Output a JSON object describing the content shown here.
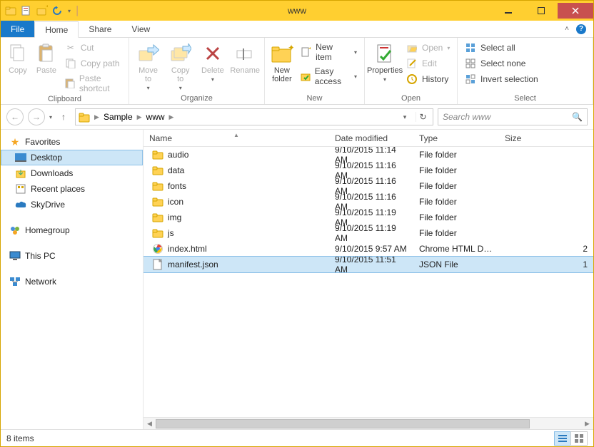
{
  "window": {
    "title": "www"
  },
  "tabs": {
    "file": "File",
    "home": "Home",
    "share": "Share",
    "view": "View"
  },
  "ribbon": {
    "clipboard": {
      "group": "Clipboard",
      "copy": "Copy",
      "paste": "Paste",
      "cut": "Cut",
      "copy_path": "Copy path",
      "paste_shortcut": "Paste shortcut"
    },
    "organize": {
      "group": "Organize",
      "move_to": "Move\nto",
      "copy_to": "Copy\nto",
      "delete": "Delete",
      "rename": "Rename"
    },
    "new": {
      "group": "New",
      "new_folder": "New\nfolder",
      "new_item": "New item",
      "easy_access": "Easy access"
    },
    "open": {
      "group": "Open",
      "properties": "Properties",
      "open": "Open",
      "edit": "Edit",
      "history": "History"
    },
    "select": {
      "group": "Select",
      "select_all": "Select all",
      "select_none": "Select none",
      "invert": "Invert selection"
    }
  },
  "nav": {
    "crumbs": [
      "Sample",
      "www"
    ],
    "search_placeholder": "Search www"
  },
  "sidebar": {
    "favorites": "Favorites",
    "items_fav": [
      "Desktop",
      "Downloads",
      "Recent places",
      "SkyDrive"
    ],
    "homegroup": "Homegroup",
    "this_pc": "This PC",
    "network": "Network"
  },
  "columns": {
    "name": "Name",
    "date": "Date modified",
    "type": "Type",
    "size": "Size"
  },
  "files": [
    {
      "icon": "folder",
      "name": "audio",
      "date": "9/10/2015 11:14 AM",
      "type": "File folder",
      "size": ""
    },
    {
      "icon": "folder",
      "name": "data",
      "date": "9/10/2015 11:16 AM",
      "type": "File folder",
      "size": ""
    },
    {
      "icon": "folder",
      "name": "fonts",
      "date": "9/10/2015 11:16 AM",
      "type": "File folder",
      "size": ""
    },
    {
      "icon": "folder",
      "name": "icon",
      "date": "9/10/2015 11:16 AM",
      "type": "File folder",
      "size": ""
    },
    {
      "icon": "folder",
      "name": "img",
      "date": "9/10/2015 11:19 AM",
      "type": "File folder",
      "size": ""
    },
    {
      "icon": "folder",
      "name": "js",
      "date": "9/10/2015 11:19 AM",
      "type": "File folder",
      "size": ""
    },
    {
      "icon": "chrome",
      "name": "index.html",
      "date": "9/10/2015 9:57 AM",
      "type": "Chrome HTML Do...",
      "size": "2"
    },
    {
      "icon": "file",
      "name": "manifest.json",
      "date": "9/10/2015 11:51 AM",
      "type": "JSON File",
      "size": "1",
      "selected": true
    }
  ],
  "status": {
    "count": "8 items"
  }
}
